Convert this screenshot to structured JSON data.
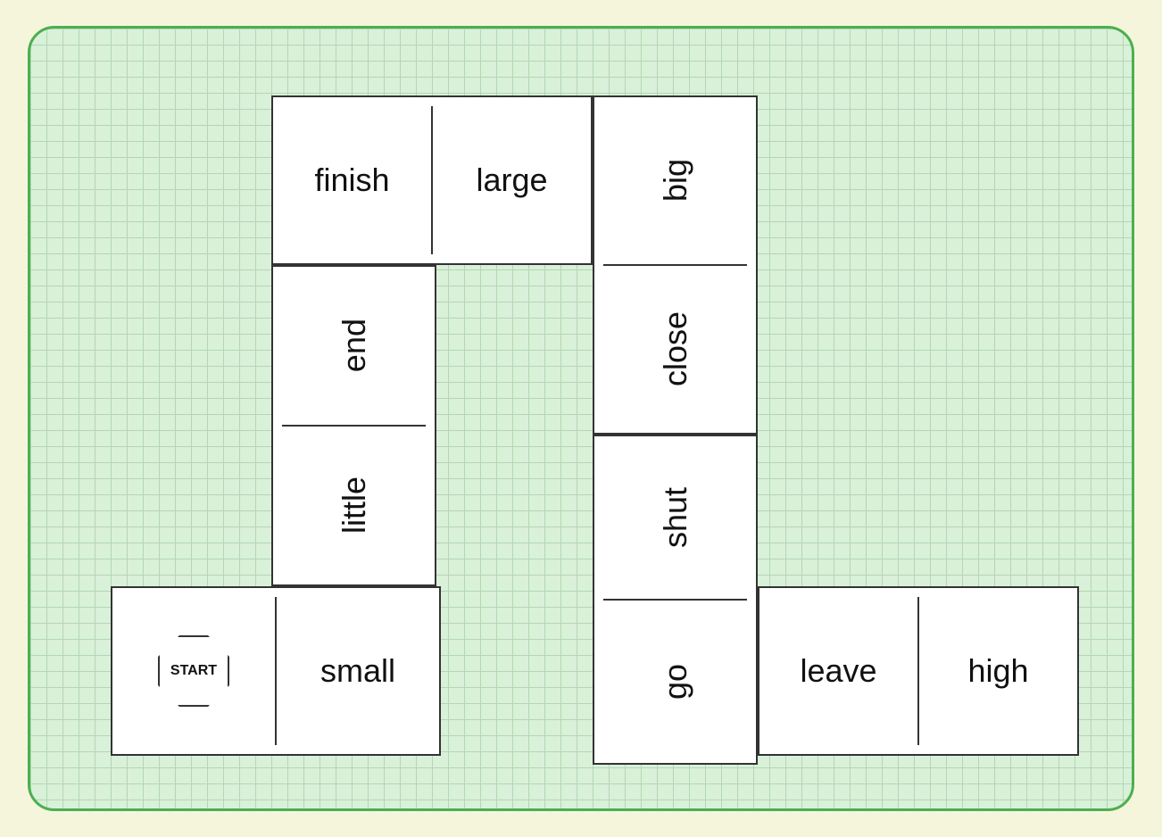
{
  "board": {
    "bg_color": "#d9f0d9",
    "border_color": "#4caf50"
  },
  "cards": {
    "card1": {
      "left_text": "finish",
      "right_text": "large",
      "type": "split-horizontal"
    },
    "card2": {
      "top_text": "big",
      "bottom_text": "close",
      "type": "split-vertical"
    },
    "card3": {
      "top_text": "end",
      "bottom_text": "little",
      "type": "split-vertical"
    },
    "card4": {
      "top_text": "shut",
      "bottom_text": "go",
      "type": "split-vertical"
    },
    "card5": {
      "start_label": "START",
      "right_text": "small",
      "type": "start-split"
    },
    "card6": {
      "left_text": "leave",
      "right_text": "high",
      "type": "split-horizontal"
    }
  }
}
